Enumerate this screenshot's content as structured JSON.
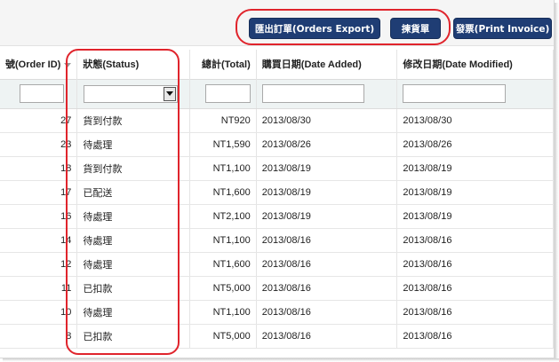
{
  "toolbar": {
    "export_label": "匯出訂單(Orders Export)",
    "pick_label": "揀貨單",
    "invoice_label": "發票(Print Invoice)"
  },
  "columns": {
    "order_id": "號(Order ID)",
    "status": "狀態(Status)",
    "total": "總計(Total)",
    "date_added": "購買日期(Date Added)",
    "date_modified": "修改日期(Date Modified)"
  },
  "filters": {
    "order_id": "",
    "status_selected": "",
    "total": "",
    "date_added": "",
    "date_modified": ""
  },
  "rows": [
    {
      "id": "27",
      "status": "貨到付款",
      "total": "NT920",
      "added": "2013/08/30",
      "modified": "2013/08/30"
    },
    {
      "id": "23",
      "status": "待處理",
      "total": "NT1,590",
      "added": "2013/08/26",
      "modified": "2013/08/26"
    },
    {
      "id": "18",
      "status": "貨到付款",
      "total": "NT1,100",
      "added": "2013/08/19",
      "modified": "2013/08/19"
    },
    {
      "id": "17",
      "status": "已配送",
      "total": "NT1,600",
      "added": "2013/08/19",
      "modified": "2013/08/19"
    },
    {
      "id": "16",
      "status": "待處理",
      "total": "NT2,100",
      "added": "2013/08/19",
      "modified": "2013/08/19"
    },
    {
      "id": "14",
      "status": "待處理",
      "total": "NT1,100",
      "added": "2013/08/16",
      "modified": "2013/08/16"
    },
    {
      "id": "12",
      "status": "待處理",
      "total": "NT1,600",
      "added": "2013/08/16",
      "modified": "2013/08/16"
    },
    {
      "id": "11",
      "status": "已扣款",
      "total": "NT5,000",
      "added": "2013/08/16",
      "modified": "2013/08/16"
    },
    {
      "id": "10",
      "status": "待處理",
      "total": "NT1,100",
      "added": "2013/08/16",
      "modified": "2013/08/16"
    },
    {
      "id": "8",
      "status": "已扣款",
      "total": "NT5,000",
      "added": "2013/08/16",
      "modified": "2013/08/16"
    }
  ],
  "colors": {
    "button_bg": "#1f3d74",
    "highlight": "#e0242c",
    "filter_row_bg": "#eef3f3"
  },
  "icons": {
    "sort": "chevron-down-icon",
    "dropdown": "chevron-down-icon"
  }
}
